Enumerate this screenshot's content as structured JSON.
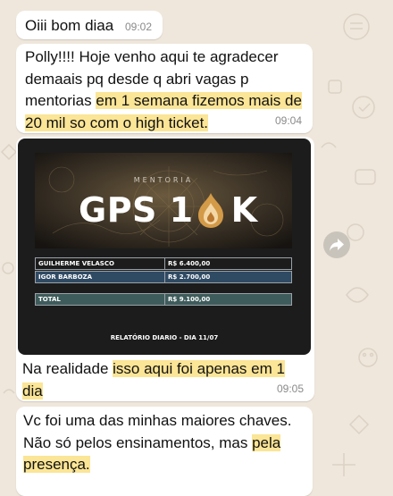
{
  "messages": [
    {
      "text": "Oiii bom diaa",
      "time": "09:02"
    },
    {
      "parts": [
        {
          "text": "Polly!!!! Hoje venho aqui te agradecer demaais pq desde q abri vagas p mentorias ",
          "highlight": false
        },
        {
          "text": "em 1 semana fizemos mais de 20 mil so com o high ticket.",
          "highlight": true
        }
      ],
      "time": "09:04"
    },
    {
      "image": {
        "brand_subtitle": "MENTORIA",
        "brand_title_left": "GPS 1",
        "brand_title_right": "K",
        "rows": [
          {
            "name": "GUILHERME VELASCO",
            "value": "R$ 6.400,00"
          },
          {
            "name": "IGOR BARBOZA",
            "value": "R$ 2.700,00"
          }
        ],
        "total_label": "TOTAL",
        "total_value": "R$ 9.100,00",
        "footer": "RELATÓRIO DIARIO - DIA 11/07"
      },
      "caption_parts": [
        {
          "text": "Na realidade ",
          "highlight": false
        },
        {
          "text": "isso aqui foi apenas em 1 dia",
          "highlight": true
        }
      ],
      "time": "09:05"
    },
    {
      "parts": [
        {
          "text": "Vc foi uma das minhas maiores chaves. Não só pelos ensinamentos, mas ",
          "highlight": false
        },
        {
          "text": "pela presença.",
          "highlight": true
        }
      ]
    }
  ],
  "colors": {
    "highlight": "#fbe596",
    "bubble": "#ffffff",
    "wallpaper": "#efe7dc",
    "timestamp": "#8a8a8a",
    "row_fill": "#2f4a63",
    "total_fill": "#3e5c5b",
    "logo_accent": "#d39a48"
  },
  "icons": {
    "forward": "forward-arrow-icon",
    "flame_logo": "flame-logo-icon"
  }
}
